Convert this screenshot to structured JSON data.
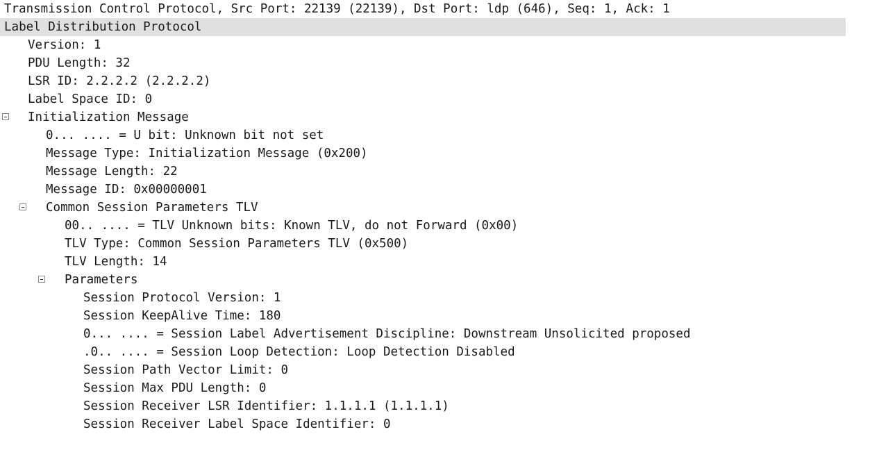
{
  "tree": {
    "tcp_line": "Transmission Control Protocol, Src Port: 22139 (22139), Dst Port: ldp (646), Seq: 1, Ack: 1",
    "ldp_header": "Label Distribution Protocol",
    "version": "Version: 1",
    "pdu_length": "PDU Length: 32",
    "lsr_id": "LSR ID: 2.2.2.2 (2.2.2.2)",
    "label_space_id": "Label Space ID: 0",
    "init_message": {
      "label": "Initialization Message",
      "u_bit": "0... .... = U bit: Unknown bit not set",
      "message_type": "Message Type: Initialization Message (0x200)",
      "message_length": "Message Length: 22",
      "message_id": "Message ID: 0x00000001",
      "common_session_tlv": {
        "label": "Common Session Parameters TLV",
        "unknown_bits": "00.. .... = TLV Unknown bits: Known TLV, do not Forward (0x00)",
        "tlv_type": "TLV Type: Common Session Parameters TLV (0x500)",
        "tlv_length": "TLV Length: 14",
        "parameters": {
          "label": "Parameters",
          "items": [
            "Session Protocol Version: 1",
            "Session KeepAlive Time: 180",
            "0... .... = Session Label Advertisement Discipline: Downstream Unsolicited proposed",
            ".0.. .... = Session Loop Detection: Loop Detection Disabled",
            "Session Path Vector Limit: 0",
            "Session Max PDU Length: 0",
            "Session Receiver LSR Identifier: 1.1.1.1 (1.1.1.1)",
            "Session Receiver Label Space Identifier: 0"
          ]
        }
      }
    }
  }
}
